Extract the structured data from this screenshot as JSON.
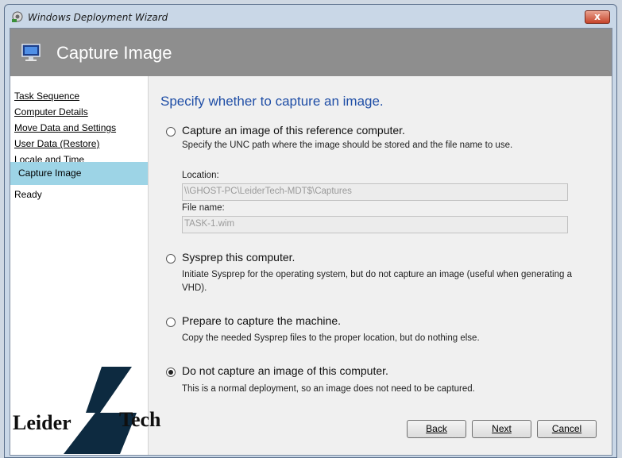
{
  "window": {
    "title": "Windows Deployment Wizard",
    "close_label": "x"
  },
  "header": {
    "title": "Capture Image"
  },
  "nav": {
    "items": [
      {
        "label": "Task Sequence"
      },
      {
        "label": "Computer Details"
      },
      {
        "label": "Move Data and Settings"
      },
      {
        "label": "User Data (Restore)"
      },
      {
        "label": "Locale and Time"
      }
    ],
    "current": "Capture Image",
    "next": "Ready"
  },
  "main": {
    "heading": "Specify whether to capture an image.",
    "options": [
      {
        "label": "Capture an image of this reference computer.",
        "description": "Specify the UNC path where the image should be stored and the file name to use.",
        "checked": false
      },
      {
        "label": "Sysprep this computer.",
        "description": "Initiate Sysprep for the operating system, but do not capture an image (useful when generating a VHD).",
        "checked": false
      },
      {
        "label": "Prepare to capture the machine.",
        "description": "Copy the needed Sysprep files to the proper location, but do nothing else.",
        "checked": false
      },
      {
        "label": "Do not capture an image of this computer.",
        "description": "This is a normal deployment, so an image does not need to be captured.",
        "checked": true
      }
    ],
    "location_label": "Location:",
    "location_value": "\\\\GHOST-PC\\LeiderTech-MDT$\\Captures",
    "filename_label": "File name:",
    "filename_value": "TASK-1.wim"
  },
  "buttons": {
    "back": "Back",
    "next": "Next",
    "cancel": "Cancel"
  },
  "watermark": {
    "left_word": "Leider",
    "right_word": "Tech"
  },
  "colors": {
    "header_bg": "#8e8e8e",
    "heading_blue": "#1f4ea6",
    "nav_selected": "#9dd4e6",
    "content_bg": "#f0f0f0"
  }
}
